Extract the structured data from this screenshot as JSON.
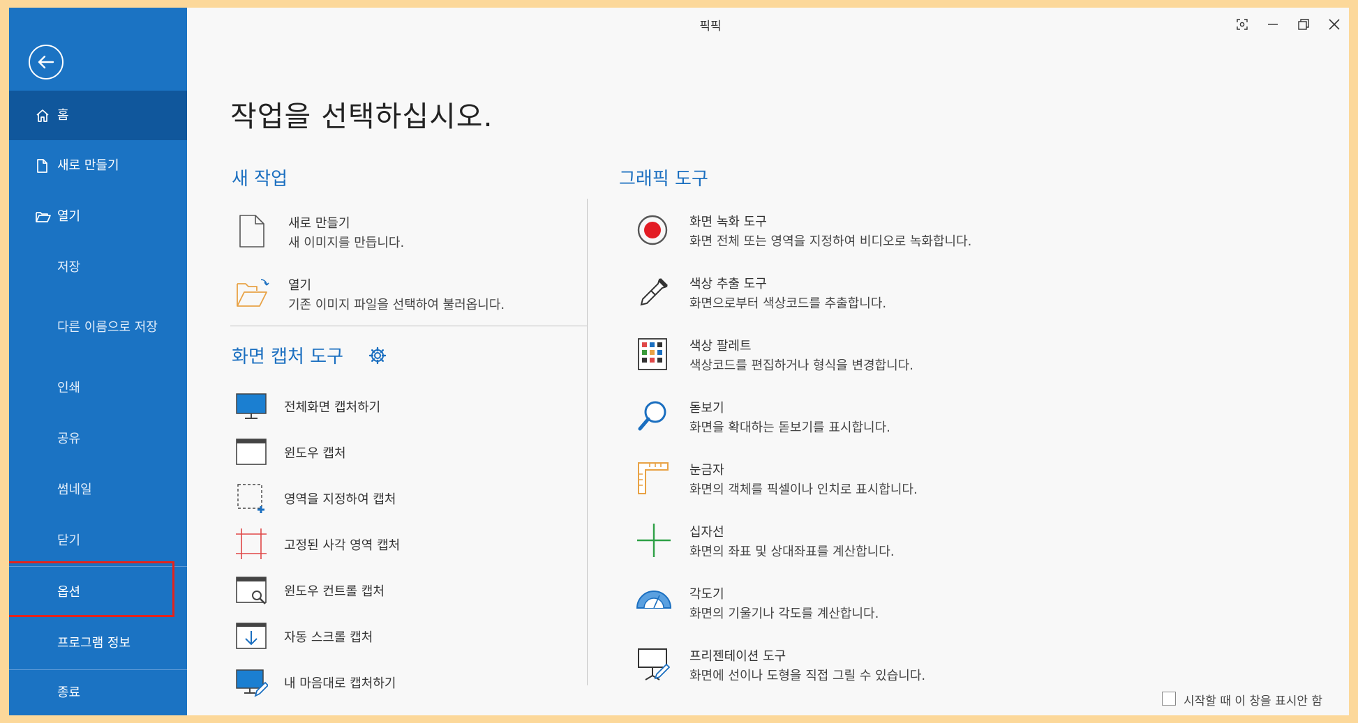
{
  "window": {
    "title": "픽픽"
  },
  "sidebar": {
    "items": [
      {
        "label": "홈",
        "icon": "home-icon",
        "active": true
      },
      {
        "label": "새로 만들기",
        "icon": "document-icon"
      },
      {
        "label": "열기",
        "icon": "folder-open-icon"
      },
      {
        "label": "저장"
      },
      {
        "label": "다른 이름으로 저장"
      },
      {
        "label": "인쇄"
      },
      {
        "label": "공유"
      },
      {
        "label": "썸네일"
      },
      {
        "label": "닫기"
      },
      {
        "label": "옵션"
      },
      {
        "label": "프로그램 정보"
      },
      {
        "label": "종료"
      }
    ]
  },
  "main": {
    "title": "작업을 선택하십시오.",
    "new_task": {
      "title": "새 작업",
      "items": [
        {
          "title": "새로 만들기",
          "desc": "새 이미지를 만듭니다."
        },
        {
          "title": "열기",
          "desc": "기존 이미지 파일을 선택하여 불러옵니다."
        }
      ]
    },
    "capture": {
      "title": "화면 캡처 도구",
      "items": [
        {
          "title": "전체화면 캡처하기"
        },
        {
          "title": "윈도우 캡처"
        },
        {
          "title": "영역을 지정하여 캡처"
        },
        {
          "title": "고정된 사각 영역 캡처"
        },
        {
          "title": "윈도우 컨트롤 캡처"
        },
        {
          "title": "자동 스크롤 캡처"
        },
        {
          "title": "내 마음대로 캡처하기"
        }
      ]
    },
    "graphic": {
      "title": "그래픽 도구",
      "items": [
        {
          "title": "화면 녹화 도구",
          "desc": "화면 전체 또는 영역을 지정하여 비디오로 녹화합니다."
        },
        {
          "title": "색상 추출 도구",
          "desc": "화면으로부터 색상코드를 추출합니다."
        },
        {
          "title": "색상 팔레트",
          "desc": "색상코드를 편집하거나 형식을 변경합니다."
        },
        {
          "title": "돋보기",
          "desc": "화면을 확대하는 돋보기를 표시합니다."
        },
        {
          "title": "눈금자",
          "desc": "화면의 객체를 픽셀이나 인치로 표시합니다."
        },
        {
          "title": "십자선",
          "desc": "화면의 좌표 및 상대좌표를 계산합니다."
        },
        {
          "title": "각도기",
          "desc": "화면의 기울기나 각도를 계산합니다."
        },
        {
          "title": "프리젠테이션 도구",
          "desc": "화면에 선이나 도형을 직접 그릴 수 있습니다."
        }
      ]
    }
  },
  "footer": {
    "startup_label": "시작할 때 이 창을 표시안 함",
    "startup_checked": false
  },
  "colors": {
    "sidebar": "#1b73c3",
    "sidebar_active": "#10579c",
    "accent": "#1b6fc0",
    "highlight": "#e3231c"
  }
}
